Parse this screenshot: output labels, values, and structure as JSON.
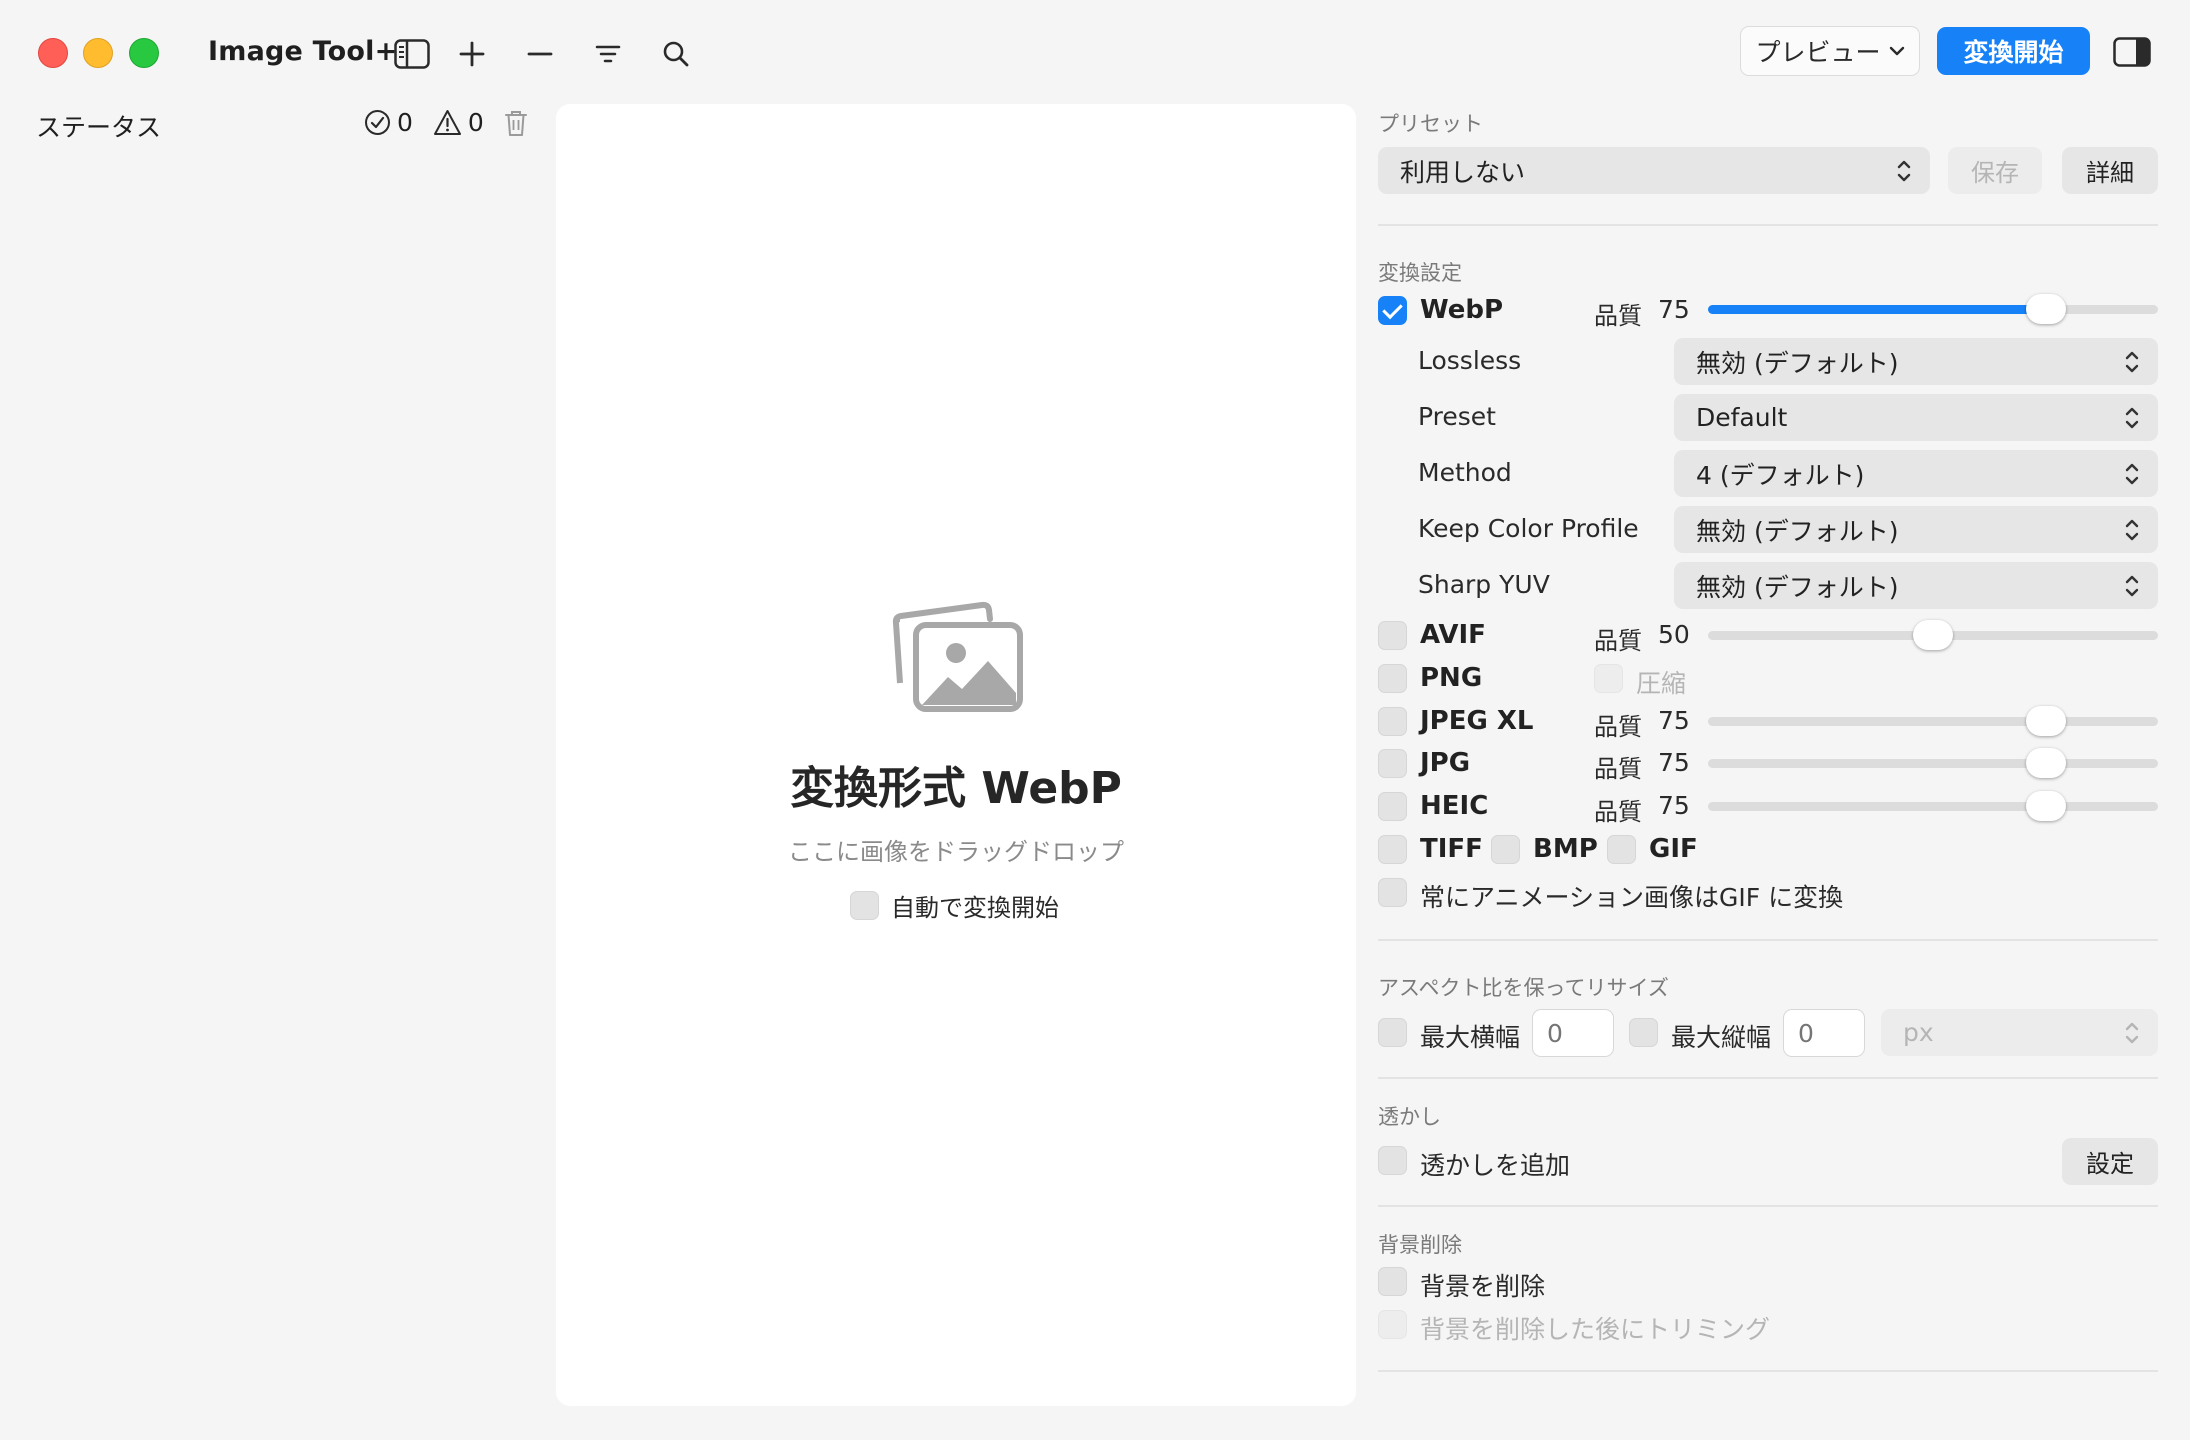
{
  "window": {
    "title": "Image Tool+"
  },
  "toolbar": {
    "preview_label": "プレビュー",
    "convert_label": "変換開始"
  },
  "status": {
    "label": "ステータス",
    "success_count": "0",
    "warning_count": "0"
  },
  "dropzone": {
    "title": "変換形式 WebP",
    "subtitle": "ここに画像をドラッグドロップ",
    "auto_convert_label": "自動で変換開始",
    "auto_convert_checked": false
  },
  "preset": {
    "section_label": "プリセット",
    "selected": "利用しない",
    "save_label": "保存",
    "detail_label": "詳細"
  },
  "conversion": {
    "section_label": "変換設定",
    "quality_label": "品質",
    "webp": {
      "label": "WebP",
      "checked": true,
      "quality": "75",
      "options": [
        {
          "label": "Lossless",
          "value": "無効 (デフォルト)"
        },
        {
          "label": "Preset",
          "value": "Default"
        },
        {
          "label": "Method",
          "value": "4 (デフォルト)"
        },
        {
          "label": "Keep Color Profile",
          "value": "無効 (デフォルト)"
        },
        {
          "label": "Sharp YUV",
          "value": "無効 (デフォルト)"
        }
      ]
    },
    "avif": {
      "label": "AVIF",
      "checked": false,
      "quality": "50"
    },
    "png": {
      "label": "PNG",
      "checked": false,
      "compress_label": "圧縮"
    },
    "jpegxl": {
      "label": "JPEG XL",
      "checked": false,
      "quality": "75"
    },
    "jpg": {
      "label": "JPG",
      "checked": false,
      "quality": "75"
    },
    "heic": {
      "label": "HEIC",
      "checked": false,
      "quality": "75"
    },
    "tiff": {
      "label": "TIFF",
      "checked": false
    },
    "bmp": {
      "label": "BMP",
      "checked": false
    },
    "gif": {
      "label": "GIF",
      "checked": false
    },
    "animation_gif_label": "常にアニメーション画像はGIF に変換"
  },
  "resize": {
    "section_label": "アスペクト比を保ってリサイズ",
    "max_width_label": "最大横幅",
    "max_width_placeholder": "0",
    "max_height_label": "最大縦幅",
    "max_height_placeholder": "0",
    "unit": "px"
  },
  "watermark": {
    "section_label": "透かし",
    "add_label": "透かしを追加",
    "settings_label": "設定"
  },
  "background": {
    "section_label": "背景削除",
    "remove_label": "背景を削除",
    "trim_label": "背景を削除した後にトリミング"
  },
  "colors": {
    "accent": "#1782f8",
    "close": "#ff5f57",
    "minimize": "#febc2e",
    "zoom": "#28c840"
  }
}
